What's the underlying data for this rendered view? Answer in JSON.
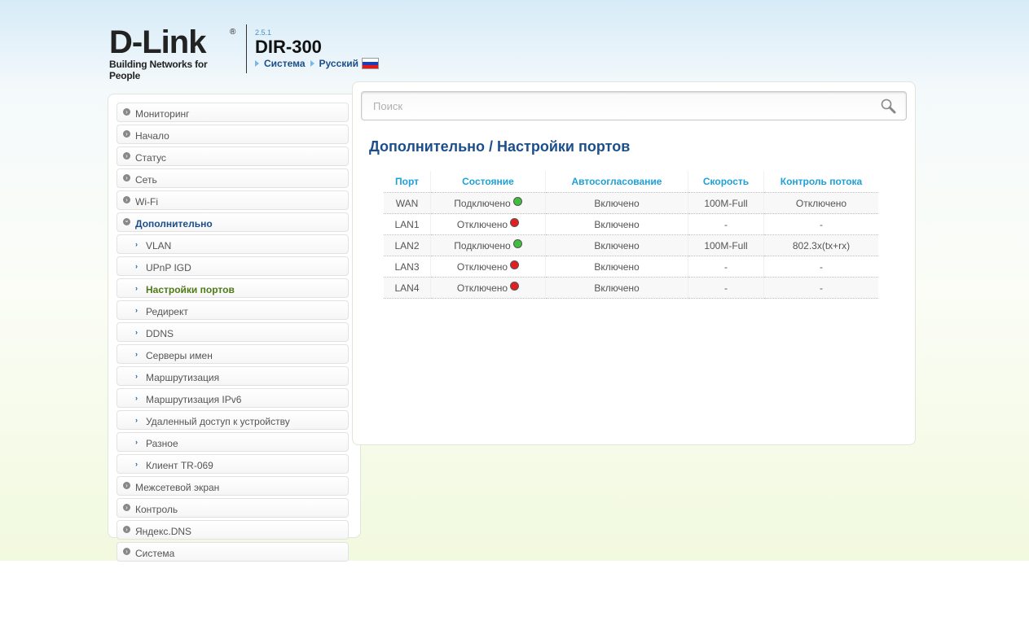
{
  "header": {
    "brand": "D-Link",
    "brand_reg": "®",
    "tagline": "Building Networks for People",
    "version": "2.5.1",
    "model": "DIR-300",
    "links": [
      "Система",
      "Русский"
    ],
    "flag_colors": [
      "#ffffff",
      "#1a3fb5",
      "#e21a1a"
    ]
  },
  "sidebar": {
    "items": [
      {
        "label": "Мониторинг",
        "level": 0,
        "state": "collapsed"
      },
      {
        "label": "Начало",
        "level": 0,
        "state": "collapsed"
      },
      {
        "label": "Статус",
        "level": 0,
        "state": "collapsed"
      },
      {
        "label": "Сеть",
        "level": 0,
        "state": "collapsed"
      },
      {
        "label": "Wi-Fi",
        "level": 0,
        "state": "collapsed"
      },
      {
        "label": "Дополнительно",
        "level": 0,
        "state": "open"
      },
      {
        "label": "VLAN",
        "level": 1
      },
      {
        "label": "UPnP IGD",
        "level": 1
      },
      {
        "label": "Настройки портов",
        "level": 1,
        "state": "active"
      },
      {
        "label": "Редирект",
        "level": 1
      },
      {
        "label": "DDNS",
        "level": 1
      },
      {
        "label": "Серверы имен",
        "level": 1
      },
      {
        "label": "Маршрутизация",
        "level": 1
      },
      {
        "label": "Маршрутизация IPv6",
        "level": 1
      },
      {
        "label": "Удаленный доступ к устройству",
        "level": 1
      },
      {
        "label": "Разное",
        "level": 1
      },
      {
        "label": "Клиент TR-069",
        "level": 1
      },
      {
        "label": "Межсетевой экран",
        "level": 0,
        "state": "collapsed"
      },
      {
        "label": "Контроль",
        "level": 0,
        "state": "collapsed"
      },
      {
        "label": "Яндекс.DNS",
        "level": 0,
        "state": "collapsed"
      },
      {
        "label": "Система",
        "level": 0,
        "state": "collapsed"
      }
    ]
  },
  "search": {
    "placeholder": "Поиск",
    "value": ""
  },
  "page": {
    "title": "Дополнительно /  Настройки портов"
  },
  "ports_table": {
    "headers": [
      "Порт",
      "Состояние",
      "Автосогласование",
      "Скорость",
      "Контроль потока"
    ],
    "rows": [
      {
        "port": "WAN",
        "state": "Подключено",
        "status_color": "#3fbf3f",
        "auto": "Включено",
        "speed": "100M-Full",
        "flow": "Отключено"
      },
      {
        "port": "LAN1",
        "state": "Отключено",
        "status_color": "#e02020",
        "auto": "Включено",
        "speed": "-",
        "flow": "-"
      },
      {
        "port": "LAN2",
        "state": "Подключено",
        "status_color": "#3fbf3f",
        "auto": "Включено",
        "speed": "100M-Full",
        "flow": "802.3x(tx+rx)"
      },
      {
        "port": "LAN3",
        "state": "Отключено",
        "status_color": "#e02020",
        "auto": "Включено",
        "speed": "-",
        "flow": "-"
      },
      {
        "port": "LAN4",
        "state": "Отключено",
        "status_color": "#e02020",
        "auto": "Включено",
        "speed": "-",
        "flow": "-"
      }
    ]
  },
  "colors": {
    "accent": "#1c4f8a",
    "header_link": "#1ea0d8",
    "active": "#4e7a17"
  }
}
